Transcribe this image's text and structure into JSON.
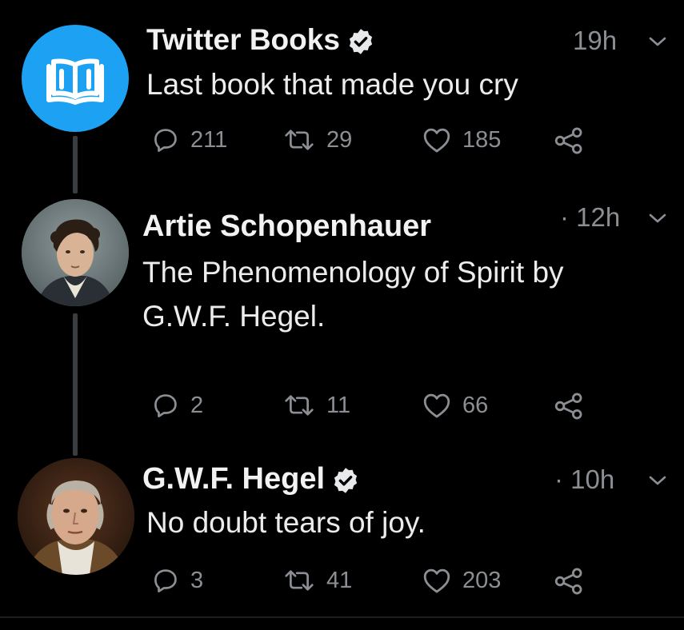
{
  "colors": {
    "background": "#000000",
    "text": "#e7e9ea",
    "muted": "#8b8f94",
    "avatar_blue": "#1da1f2",
    "thread_line": "#3a3d40"
  },
  "tweets": [
    {
      "name": "Twitter Books",
      "verified": true,
      "time": "19h",
      "text_lines": [
        "Last book that made you cry"
      ],
      "replies": "211",
      "retweets": "29",
      "likes": "185",
      "avatar_icon": "open-book-icon"
    },
    {
      "name": "Artie Schopenhauer",
      "verified": false,
      "time": "· 12h",
      "text_lines": [
        "The Phenomenology of Spirit by",
        "G.W.F. Hegel."
      ],
      "replies": "2",
      "retweets": "11",
      "likes": "66",
      "avatar_icon": "portrait-avatar"
    },
    {
      "name": "G.W.F. Hegel",
      "verified": true,
      "time": "· 10h",
      "text_lines": [
        "No doubt tears of joy."
      ],
      "replies": "3",
      "retweets": "41",
      "likes": "203",
      "avatar_icon": "portrait-avatar"
    }
  ]
}
